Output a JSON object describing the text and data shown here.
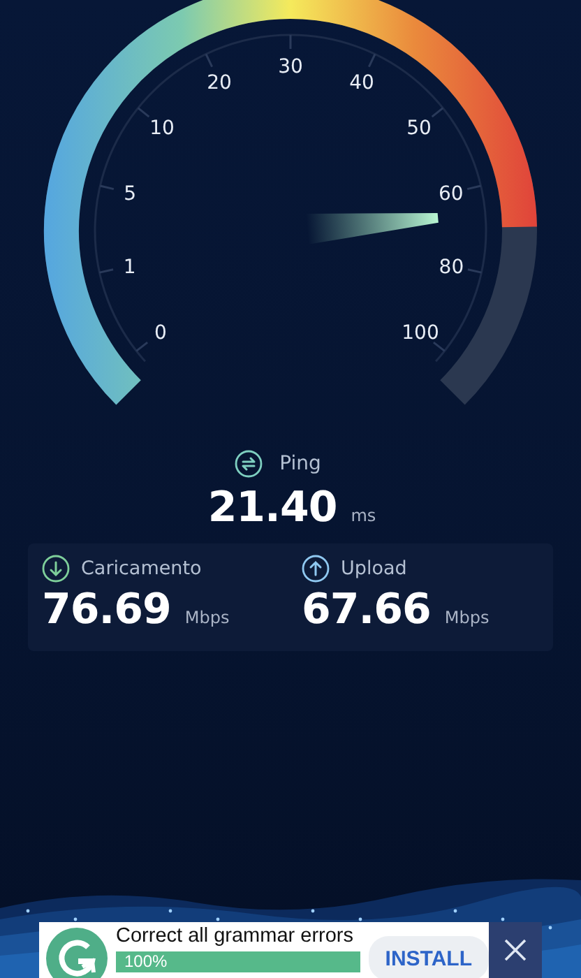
{
  "gauge": {
    "scale_labels": [
      "0",
      "1",
      "5",
      "10",
      "20",
      "30",
      "40",
      "50",
      "60",
      "80",
      "100"
    ]
  },
  "ping": {
    "label": "Ping",
    "value": "21.40",
    "unit": "ms"
  },
  "results": [
    {
      "kind": "download",
      "label": "Caricamento",
      "value": "76.69",
      "unit": "Mbps"
    },
    {
      "kind": "upload",
      "label": "Upload",
      "value": "67.66",
      "unit": "Mbps"
    }
  ],
  "ad": {
    "headline": "Correct all grammar errors",
    "progress": {
      "text": "100%"
    },
    "button": "INSTALL"
  }
}
